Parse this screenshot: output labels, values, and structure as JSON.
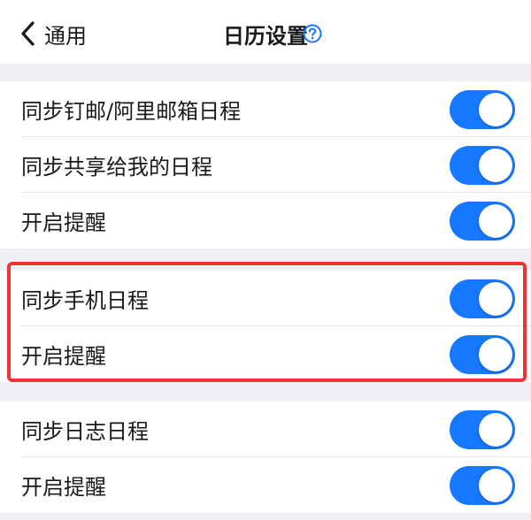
{
  "header": {
    "back_label": "通用",
    "title": "日历设置",
    "back_icon": "chevron-left-icon",
    "help_icon": "question-circle-icon",
    "accent_color": "#1677ff"
  },
  "groups": [
    {
      "rows": [
        {
          "label": "同步钉邮/阿里邮箱日程",
          "enabled": true
        },
        {
          "label": "同步共享给我的日程",
          "enabled": true
        },
        {
          "label": "开启提醒",
          "enabled": true
        }
      ]
    },
    {
      "rows": [
        {
          "label": "同步手机日程",
          "enabled": true
        },
        {
          "label": "开启提醒",
          "enabled": true
        }
      ]
    },
    {
      "rows": [
        {
          "label": "同步日志日程",
          "enabled": true
        },
        {
          "label": "开启提醒",
          "enabled": true
        }
      ]
    }
  ],
  "highlight_color": "#f03434"
}
